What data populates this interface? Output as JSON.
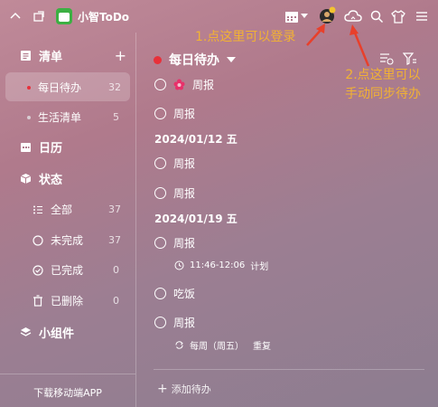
{
  "app": {
    "title": "小智ToDo"
  },
  "annotations": {
    "login": "1.点这里可以登录",
    "sync_line1": "2.点这里可以",
    "sync_line2": "手动同步待办"
  },
  "sidebar": {
    "list_header": "清单",
    "add_symbol": "+",
    "lists": [
      {
        "label": "每日待办",
        "count": "32",
        "dot_color": "#e8303a"
      },
      {
        "label": "生活清单",
        "count": "5",
        "dot_color": "#d9cdd3"
      }
    ],
    "calendar_header": "日历",
    "status_header": "状态",
    "status_items": [
      {
        "label": "全部",
        "count": "37"
      },
      {
        "label": "未完成",
        "count": "37"
      },
      {
        "label": "已完成",
        "count": "0"
      },
      {
        "label": "已删除",
        "count": "0"
      }
    ],
    "widgets_header": "小组件",
    "download": "下载移动端APP"
  },
  "main": {
    "list_title": "每日待办",
    "tasks_top": [
      {
        "label": "周报",
        "flower": true
      },
      {
        "label": "周报"
      }
    ],
    "group1_date": "2024/01/12 五",
    "group1_tasks": [
      {
        "label": "周报"
      },
      {
        "label": "周报"
      }
    ],
    "group2_date": "2024/01/19 五",
    "task_time": {
      "label": "周报",
      "time": "11:46-12:06",
      "tag": "计划"
    },
    "task_plain": {
      "label": "吃饭"
    },
    "task_repeat": {
      "label": "周报",
      "repeat": "每周（周五）",
      "tag": "重复"
    },
    "add_task": "添加待办"
  },
  "icons": [
    "collapse-icon",
    "pin-icon",
    "calendar-icon",
    "avatar",
    "cloud-sync-icon",
    "search-icon",
    "shirt-icon",
    "menu-icon",
    "sort-icon",
    "filter-icon"
  ]
}
